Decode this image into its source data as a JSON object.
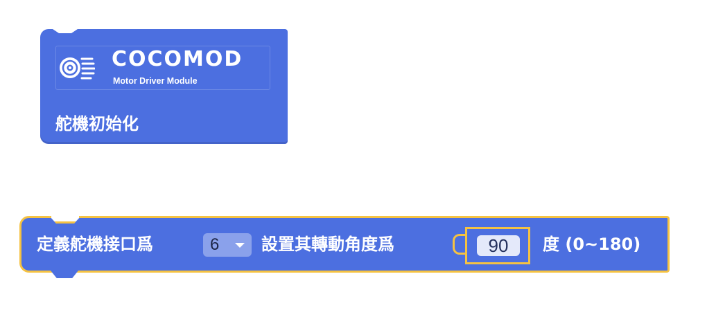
{
  "init_block": {
    "logo_title": "COCOMOD",
    "logo_subtitle": "Motor Driver Module",
    "label": "舵機初始化",
    "logo_icon": "motor-icon"
  },
  "servo_block": {
    "label_prefix": "定義舵機接口爲",
    "port_value": "6",
    "label_middle": "設置其轉動角度爲",
    "angle_value": "90",
    "label_suffix": "度 (0~180)",
    "dropdown_icon": "chevron-down-icon"
  },
  "colors": {
    "block_blue": "#4c6fe0",
    "selection_outline": "#f5c242",
    "text": "#ffffff"
  }
}
